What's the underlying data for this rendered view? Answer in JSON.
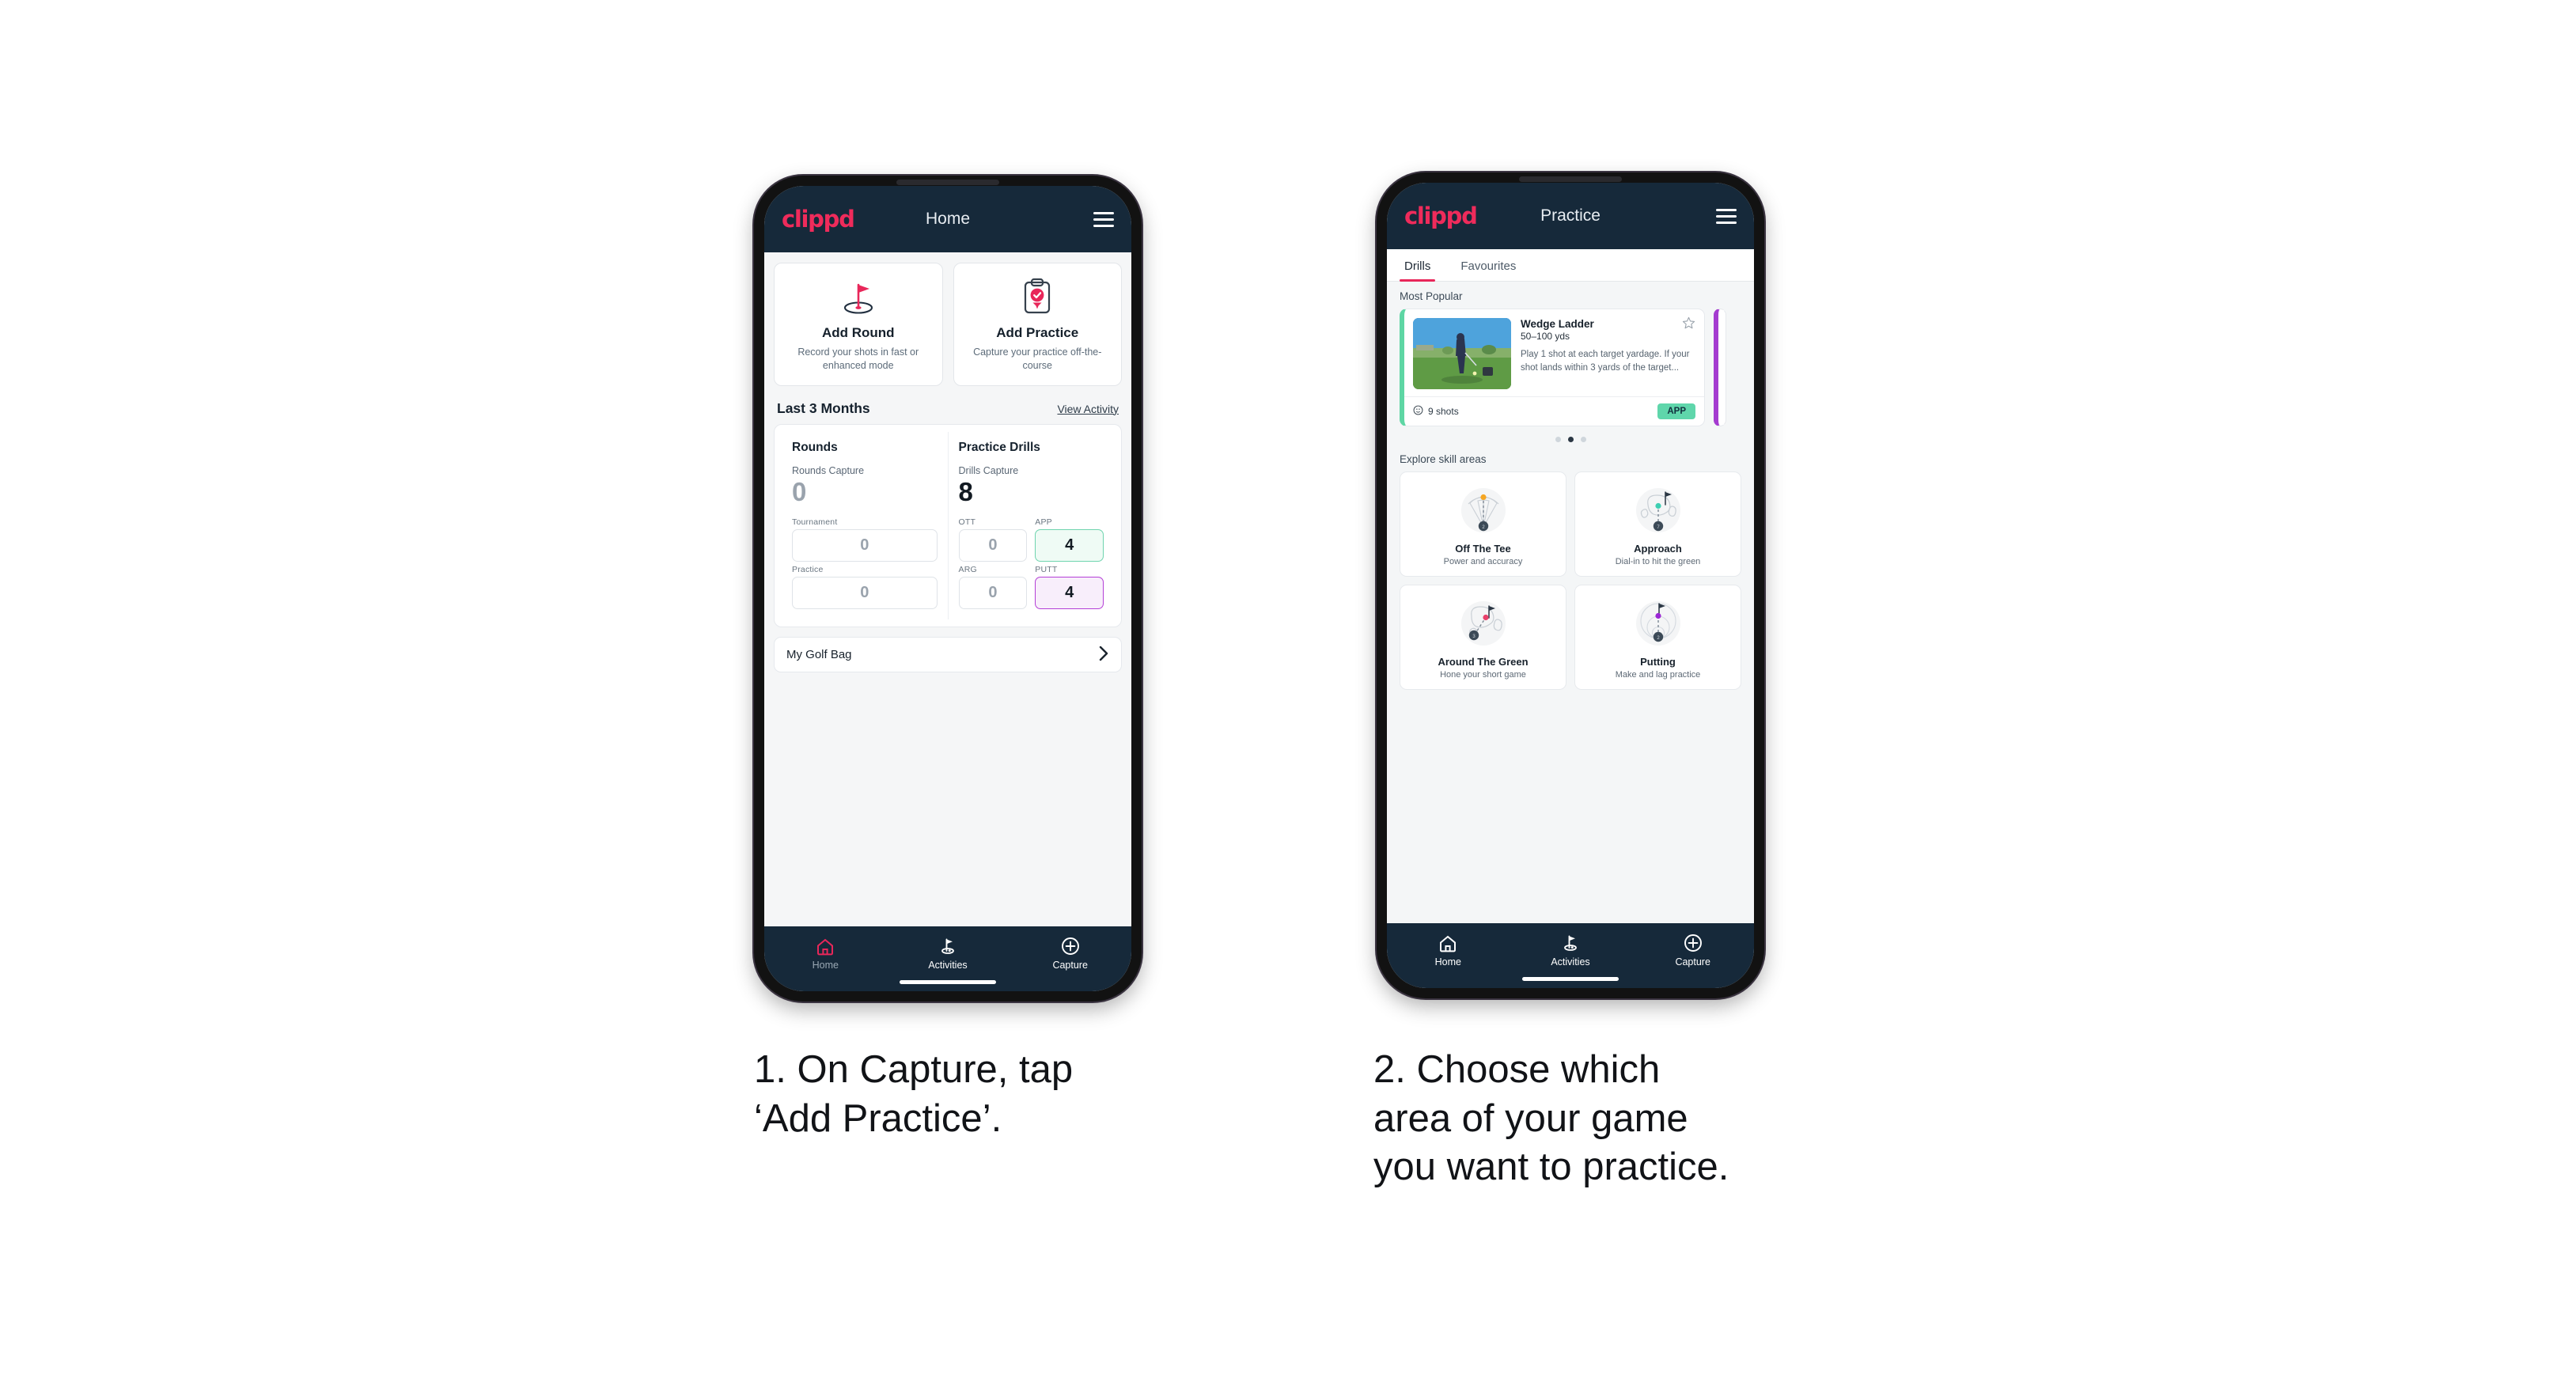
{
  "brand": {
    "logo_text": "clippd",
    "accent": "#ef2b5b",
    "header_bg": "#16293a"
  },
  "phone1": {
    "header": {
      "title": "Home",
      "menu_icon": "hamburger-icon"
    },
    "actions": [
      {
        "icon": "golf-flag-hole-icon",
        "title": "Add Round",
        "subtitle": "Record your shots in fast or enhanced mode"
      },
      {
        "icon": "clipboard-check-icon",
        "title": "Add Practice",
        "subtitle": "Capture your practice off-the-course"
      }
    ],
    "section": {
      "title": "Last 3 Months",
      "link": "View Activity"
    },
    "stats": [
      {
        "heading": "Rounds",
        "capture_label": "Rounds Capture",
        "capture_value": "0",
        "capture_is_zero": true,
        "metrics": [
          {
            "label": "Tournament",
            "value": "0",
            "highlight": "none"
          },
          {
            "label": "Practice",
            "value": "0",
            "highlight": "none"
          }
        ]
      },
      {
        "heading": "Practice Drills",
        "capture_label": "Drills Capture",
        "capture_value": "8",
        "capture_is_zero": false,
        "metrics": [
          {
            "label": "OTT",
            "value": "0",
            "highlight": "none"
          },
          {
            "label": "APP",
            "value": "4",
            "highlight": "green"
          },
          {
            "label": "ARG",
            "value": "0",
            "highlight": "none"
          },
          {
            "label": "PUTT",
            "value": "4",
            "highlight": "purple"
          }
        ]
      }
    ],
    "golf_bag": {
      "label": "My Golf Bag",
      "chevron": "chevron-right-icon"
    },
    "nav": [
      {
        "icon": "home-icon",
        "label": "Home",
        "active": true
      },
      {
        "icon": "golf-flag-icon",
        "label": "Activities",
        "active": false
      },
      {
        "icon": "plus-circle-icon",
        "label": "Capture",
        "active": false
      }
    ]
  },
  "phone2": {
    "header": {
      "title": "Practice",
      "menu_icon": "hamburger-icon"
    },
    "tabs": [
      {
        "label": "Drills",
        "active": true
      },
      {
        "label": "Favourites",
        "active": false
      }
    ],
    "most_popular_label": "Most Popular",
    "drill": {
      "title": "Wedge Ladder",
      "yardage": "50–100 yds",
      "description": "Play 1 shot at each target yardage. If your shot lands within 3 yards of the target...",
      "shots": "9 shots",
      "shots_icon": "clock-icon",
      "badge": "APP",
      "badge_color": "#5fd6ab",
      "favourite_icon": "star-outline-icon",
      "accent_edge": "#5ed6a4",
      "next_card_edge": "#a43bd0"
    },
    "carousel_dots": {
      "count": 3,
      "active_index": 1
    },
    "skill_head": "Explore skill areas",
    "skill_areas": [
      {
        "icon": "tee-shot-fan-icon",
        "title": "Off The Tee",
        "subtitle": "Power and accuracy",
        "dot_color": "#f5a623"
      },
      {
        "icon": "approach-green-icon",
        "title": "Approach",
        "subtitle": "Dial-in to hit the green",
        "dot_color": "#3ecfb2"
      },
      {
        "icon": "chip-green-icon",
        "title": "Around The Green",
        "subtitle": "Hone your short game",
        "dot_color": "#e8416b"
      },
      {
        "icon": "putting-rings-icon",
        "title": "Putting",
        "subtitle": "Make and lag practice",
        "dot_color": "#9b27d4"
      }
    ],
    "nav": [
      {
        "icon": "home-icon",
        "label": "Home",
        "active": false
      },
      {
        "icon": "golf-flag-icon",
        "label": "Activities",
        "active": false
      },
      {
        "icon": "plus-circle-icon",
        "label": "Capture",
        "active": false
      }
    ]
  },
  "captions": [
    {
      "text": "1. On Capture, tap\n‘Add Practice’."
    },
    {
      "text": "2. Choose which\narea of your game\nyou want to practice."
    }
  ]
}
